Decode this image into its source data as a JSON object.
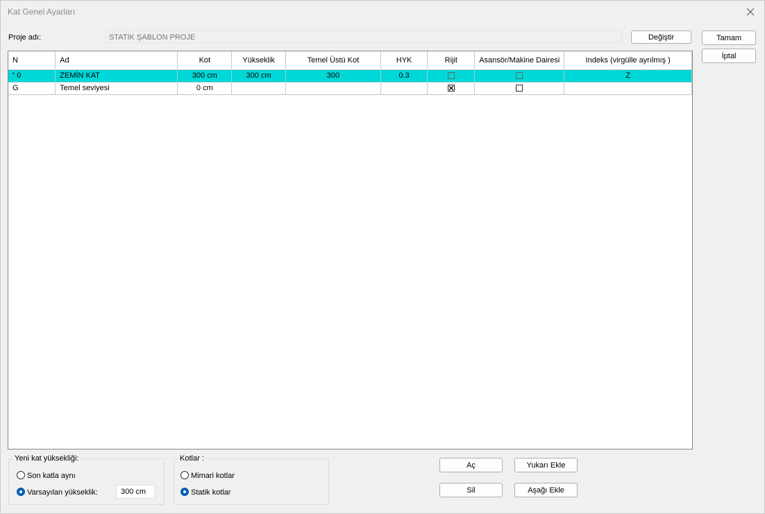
{
  "window": {
    "title": "Kat Genel Ayarları"
  },
  "project": {
    "label": "Proje adı:",
    "value": "STATİK ŞABLON PROJE",
    "change_button": "Değiştir"
  },
  "dialog_buttons": {
    "ok": "Tamam",
    "cancel": "İptal"
  },
  "table": {
    "columns": [
      "N",
      "Ad",
      "Kot",
      "Yükseklik",
      "Temel Üstü Kot",
      "HYK",
      "Rijit",
      "Asansör/Makine Dairesi",
      "Indeks (virgülle ayrılmış )"
    ],
    "rows": [
      {
        "n": "0",
        "marker": "*",
        "ad": "ZEMİN KAT",
        "kot": "300 cm",
        "yukseklik": "300 cm",
        "temel_ustu_kot": "300",
        "hyk": "0.3",
        "rijit": false,
        "asansor": false,
        "indeks": "Z",
        "selected": true
      },
      {
        "n": "G",
        "marker": "",
        "ad": "Temel seviyesi",
        "kot": "0 cm",
        "yukseklik": "",
        "temel_ustu_kot": "",
        "hyk": "",
        "rijit": true,
        "asansor": false,
        "indeks": "",
        "selected": false
      }
    ]
  },
  "new_floor_height": {
    "title": "Yeni kat yüksekliği:",
    "option_same": "Son katla aynı",
    "option_default": "Varsayılan yükseklik:",
    "selected": "default",
    "default_value": "300 cm"
  },
  "levels": {
    "title": "Kotlar :",
    "option_architectural": "Mimari kotlar",
    "option_structural": "Statik kotlar",
    "selected": "structural"
  },
  "action_buttons": {
    "open": "Aç",
    "delete": "Sil",
    "add_above": "Yukarı Ekle",
    "add_below": "Aşağı Ekle"
  },
  "colors": {
    "selection": "#00d8d8",
    "radio_accent": "#005fb8"
  }
}
